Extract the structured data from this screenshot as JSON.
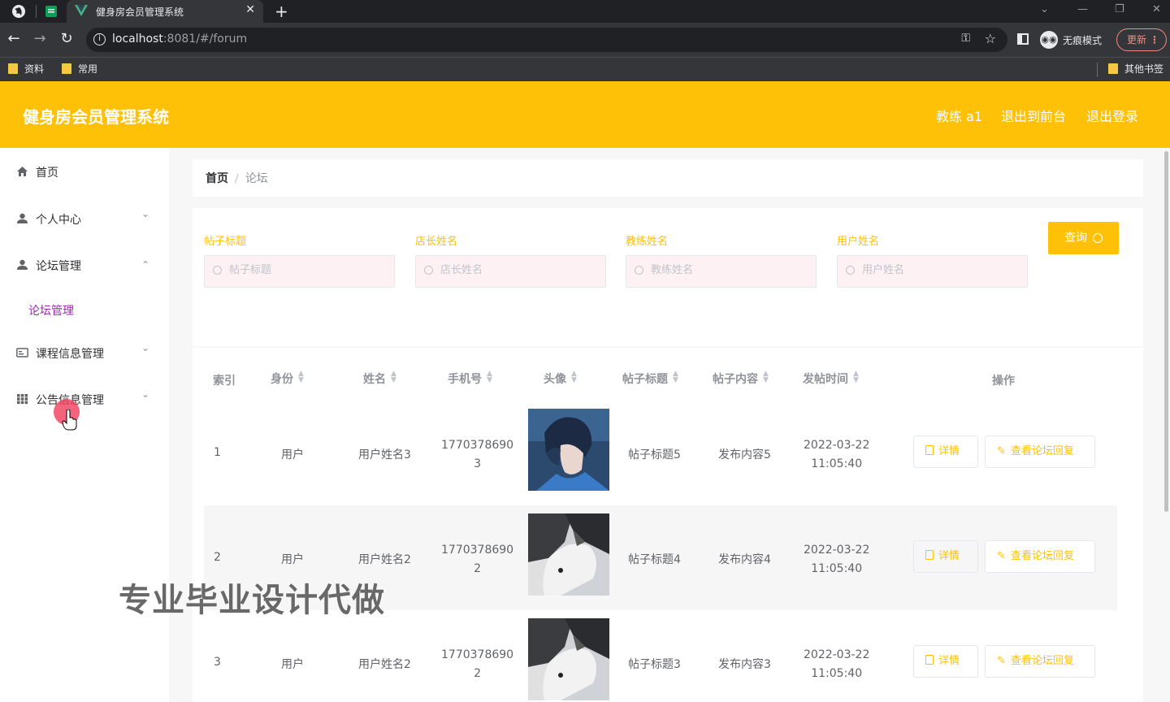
{
  "browser": {
    "tab_title": "健身房会员管理系统",
    "tab_close": "✕",
    "new_tab": "+",
    "url_host": "localhost",
    "url_rest": ":8081/#/forum",
    "incognito_label": "无痕模式",
    "update_label": "更新",
    "bookmarks": [
      "资料",
      "常用"
    ],
    "other_bookmarks": "其他书签"
  },
  "header": {
    "title": "健身房会员管理系统",
    "user": "教练 a1",
    "back_front": "退出到前台",
    "logout": "退出登录"
  },
  "sidebar": {
    "items": [
      {
        "label": "首页",
        "icon": "home-icon"
      },
      {
        "label": "个人中心",
        "icon": "user-icon"
      },
      {
        "label": "论坛管理",
        "icon": "user-icon"
      },
      {
        "label": "课程信息管理",
        "icon": "card-icon"
      },
      {
        "label": "公告信息管理",
        "icon": "grid-icon"
      }
    ],
    "sub_item": "论坛管理"
  },
  "breadcrumb": {
    "home": "首页",
    "sep": "/",
    "current": "论坛"
  },
  "search": {
    "fields": [
      {
        "label": "帖子标题",
        "placeholder": "帖子标题"
      },
      {
        "label": "店长姓名",
        "placeholder": "店长姓名"
      },
      {
        "label": "教练姓名",
        "placeholder": "教练姓名"
      },
      {
        "label": "用户姓名",
        "placeholder": "用户姓名"
      }
    ],
    "button": "查询"
  },
  "table": {
    "columns": [
      "索引",
      "身份",
      "姓名",
      "手机号",
      "头像",
      "帖子标题",
      "帖子内容",
      "发帖时间",
      "操作"
    ],
    "rows": [
      {
        "index": "1",
        "role": "用户",
        "name": "用户姓名3",
        "phone_a": "1770378690",
        "phone_b": "3",
        "title": "帖子标题5",
        "content": "发布内容5",
        "date": "2022-03-22",
        "time": "11:05:40",
        "avatar": "anime-portrait"
      },
      {
        "index": "2",
        "role": "用户",
        "name": "用户姓名2",
        "phone_a": "1770378690",
        "phone_b": "2",
        "title": "帖子标题4",
        "content": "发布内容4",
        "date": "2022-03-22",
        "time": "11:05:40",
        "avatar": "husky-dog"
      },
      {
        "index": "3",
        "role": "用户",
        "name": "用户姓名2",
        "phone_a": "1770378690",
        "phone_b": "2",
        "title": "帖子标题3",
        "content": "发布内容3",
        "date": "2022-03-22",
        "time": "11:05:40",
        "avatar": "husky-dog"
      }
    ],
    "detail_btn": "详情",
    "reply_btn": "查看论坛回复"
  },
  "watermark": "专业毕业设计代做",
  "colors": {
    "accent": "#ffc107",
    "submenu_active": "#9c27b0",
    "browser_dark": "#35363a"
  }
}
